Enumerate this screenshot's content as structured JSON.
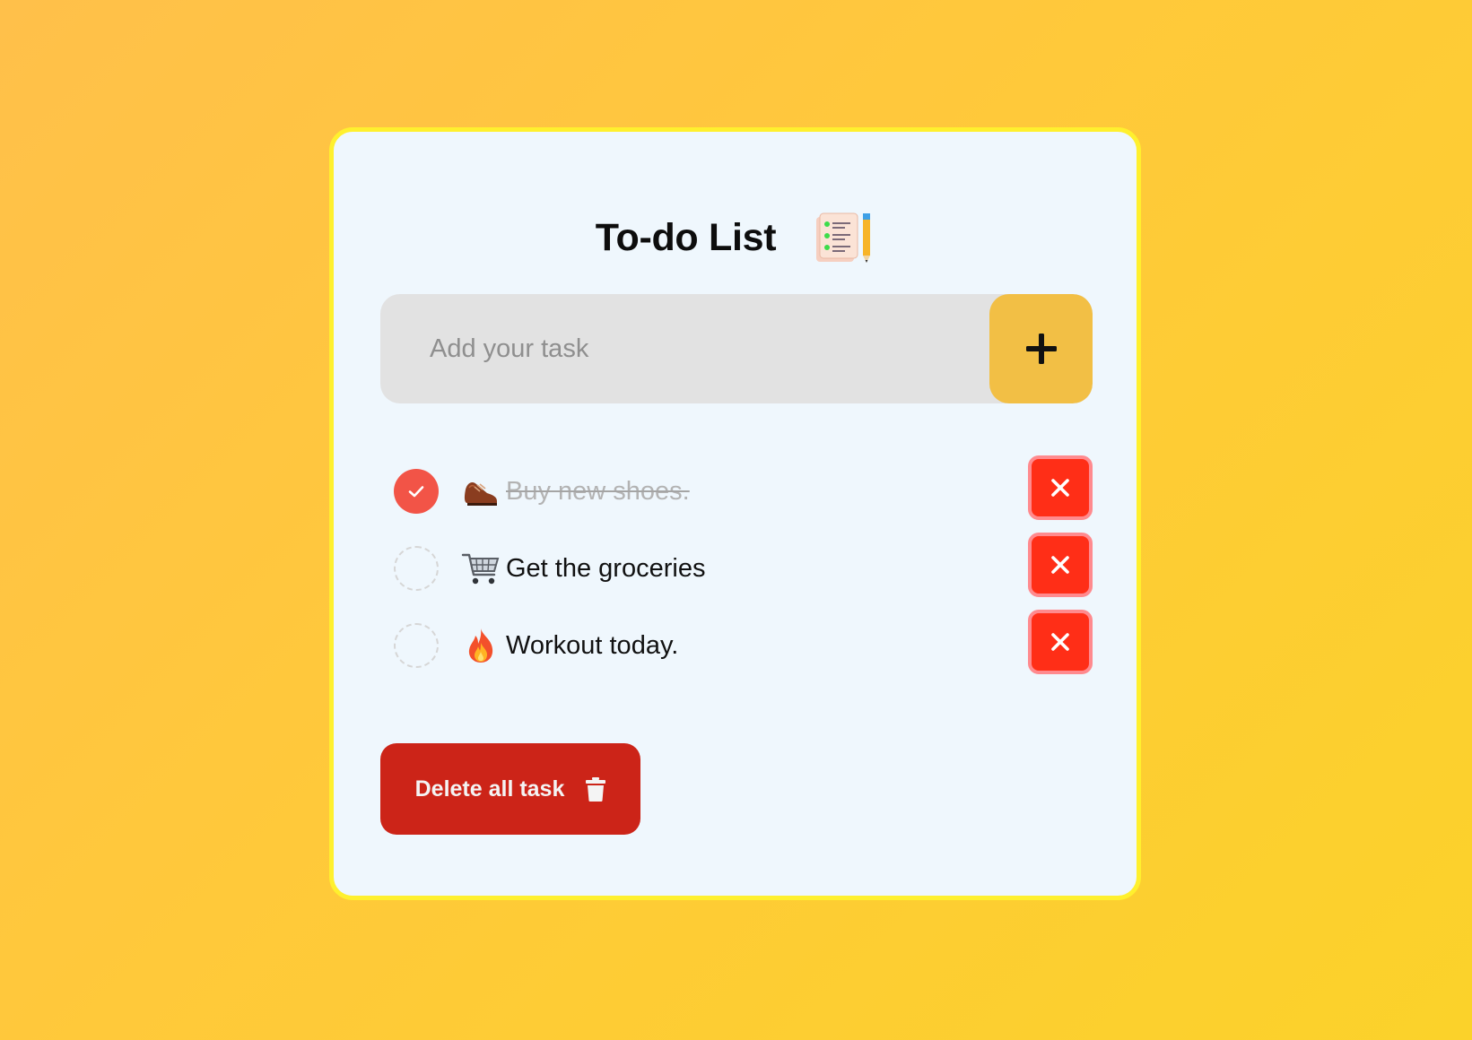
{
  "app": {
    "title": "To-do List",
    "title_icon": "notepad-pencil-icon"
  },
  "input": {
    "placeholder": "Add your task",
    "value": "",
    "add_button_icon": "plus-icon"
  },
  "tasks": [
    {
      "emoji": "shoe-icon",
      "text": "Buy new shoes.",
      "done": true
    },
    {
      "emoji": "shopping-cart-icon",
      "text": "Get the groceries",
      "done": false
    },
    {
      "emoji": "fire-icon",
      "text": "Workout today.",
      "done": false
    }
  ],
  "actions": {
    "delete_all_label": "Delete all task",
    "delete_all_icon": "trash-icon",
    "remove_task_icon": "close-icon"
  },
  "colors": {
    "background_start": "#ffc04a",
    "background_end": "#fbd22a",
    "card": "#eff7fd",
    "card_border": "#fff02e",
    "input_bg": "#e2e2e2",
    "add_button": "#f2bf45",
    "checked": "#f25447",
    "remove_button": "#ff2e17",
    "delete_all_button": "#cc2418"
  }
}
